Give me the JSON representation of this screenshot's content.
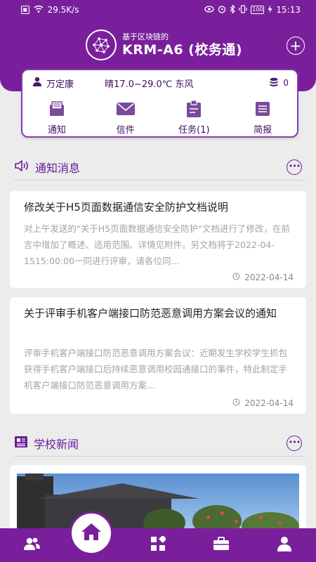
{
  "status_bar": {
    "network_speed": "29.5K/s",
    "battery": "100",
    "time": "15:13"
  },
  "brand": {
    "tagline": "基于区块链的",
    "app_title": "KRM-A6 (校务通)"
  },
  "user_card": {
    "user_name": "万定康",
    "weather": "晴17.0~29.0℃ 东风",
    "coins": "0",
    "quick_links": [
      "通知",
      "信件",
      "任务(1)",
      "简报"
    ]
  },
  "notices": {
    "section_title": "通知消息",
    "items": [
      {
        "title": "修改关于H5页面数据通信安全防护文档说明",
        "body": "对上午发送的\"关于H5页面数据通信安全防护\"文档进行了修改，在前言中增加了概述、适用范围。详情见附件。另文档将于2022-04-1515:00:00一同进行评审，请各位同...",
        "date": "2022-04-14"
      },
      {
        "title": "关于评审手机客户端接口防范恶意调用方案会议的通知",
        "body": "评审手机客户端接口防范恶意调用方案会议：近期发生学校学生抓包获得手机客户端接口后持续恶意调用校园通接口的事件，特此制定手机客户端接口防范恶意调用方案...",
        "date": "2022-04-14"
      }
    ]
  },
  "school_news": {
    "section_title": "学校新闻"
  },
  "tab_bar": {
    "tabs": [
      "contacts-icon",
      "home-icon",
      "apps-icon",
      "briefcase-icon",
      "profile-icon"
    ]
  },
  "colors": {
    "primary": "#7a1f9c",
    "accent_border": "#8a3aa8",
    "text_dark": "#222222",
    "text_muted": "#a3a3a3"
  }
}
